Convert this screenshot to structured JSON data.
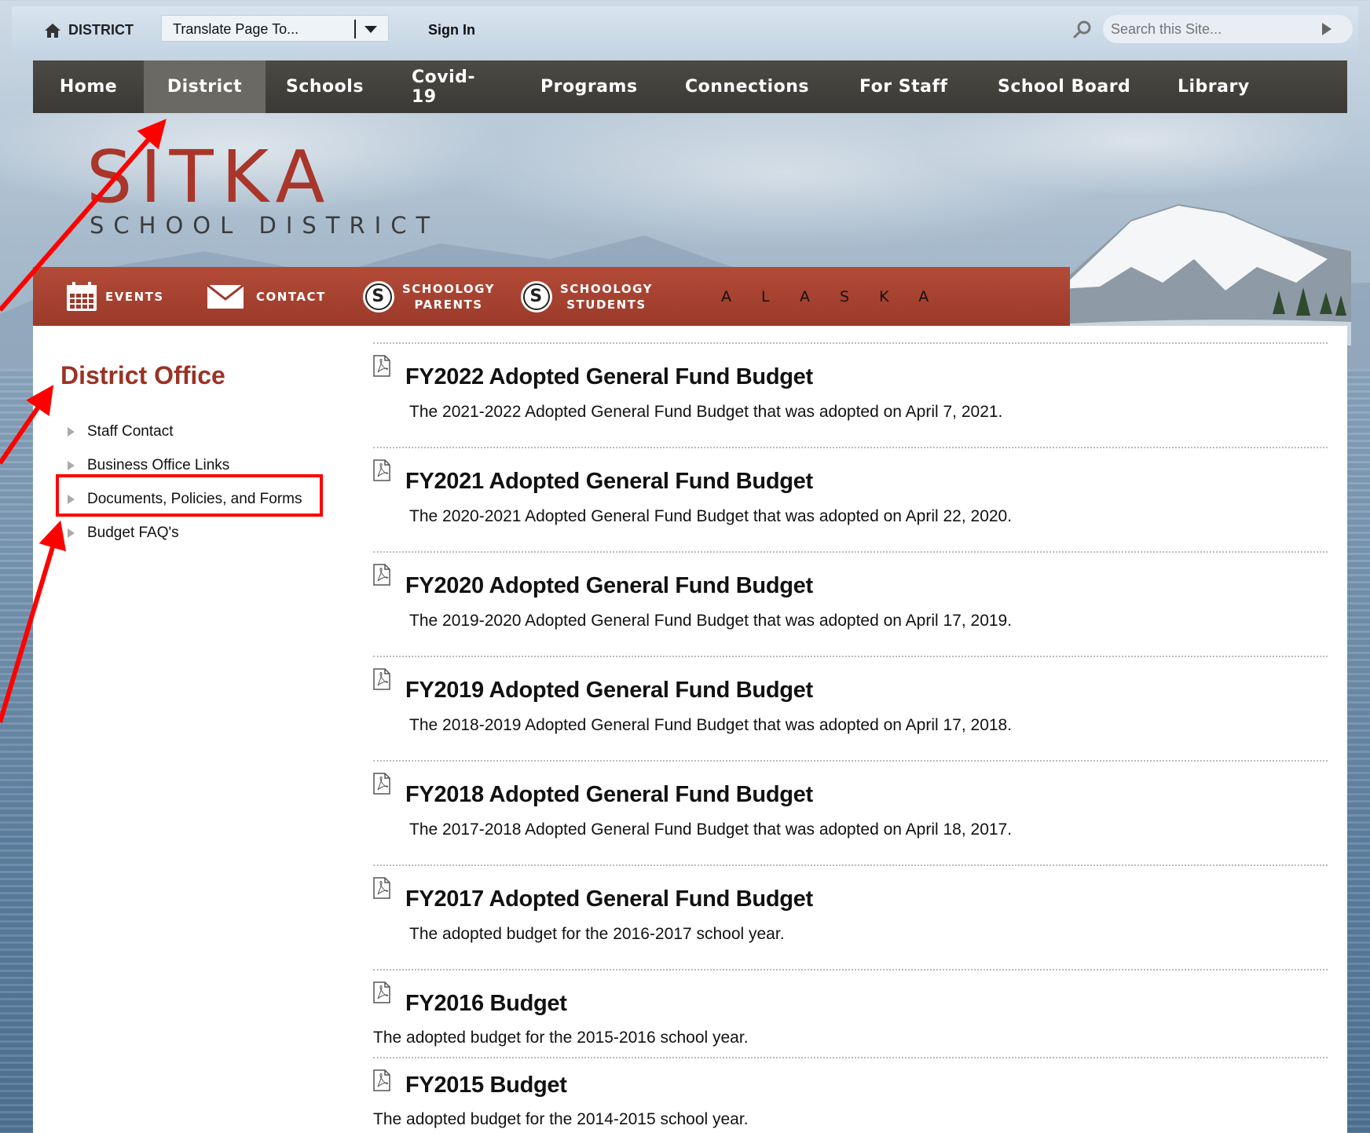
{
  "utility_bar": {
    "home_label": "DISTRICT",
    "translate_label": "Translate Page To...",
    "signin_label": "Sign In",
    "search_placeholder": "Search this Site..."
  },
  "main_nav": {
    "items": [
      {
        "label": "Home"
      },
      {
        "label": "District",
        "active": true
      },
      {
        "label": "Schools"
      },
      {
        "label": "Covid-19"
      },
      {
        "label": "Programs"
      },
      {
        "label": "Connections"
      },
      {
        "label": "For Staff"
      },
      {
        "label": "School Board"
      },
      {
        "label": "Library"
      }
    ]
  },
  "logo": {
    "title": "SITKA",
    "subtitle": "SCHOOL DISTRICT"
  },
  "quick_links": {
    "events": "EVENTS",
    "contact": "CONTACT",
    "schoology_parents": [
      "SCHOOLOGY",
      "PARENTS"
    ],
    "schoology_students": [
      "SCHOOLOGY",
      "STUDENTS"
    ],
    "schoology_letter": "S",
    "region": "ALASKA"
  },
  "sidebar": {
    "title": "District Office",
    "items": [
      {
        "label": "Staff Contact"
      },
      {
        "label": "Business Office Links"
      },
      {
        "label": "Documents, Policies, and Forms"
      },
      {
        "label": "Budget FAQ's"
      }
    ]
  },
  "documents": [
    {
      "title": "FY2022 Adopted General Fund Budget",
      "desc": "The 2021-2022 Adopted General Fund Budget that was adopted on April 7, 2021."
    },
    {
      "title": "FY2021 Adopted General Fund Budget",
      "desc": "The 2020-2021 Adopted General Fund Budget that was adopted on April 22, 2020."
    },
    {
      "title": "FY2020 Adopted General Fund Budget",
      "desc": "The 2019-2020 Adopted General Fund Budget that was adopted on April 17, 2019."
    },
    {
      "title": "FY2019 Adopted General Fund Budget",
      "desc": "The 2018-2019 Adopted General Fund Budget that was adopted on April 17, 2018."
    },
    {
      "title": "FY2018 Adopted General Fund Budget",
      "desc": "The 2017-2018 Adopted General Fund Budget that was adopted on April 18, 2017."
    },
    {
      "title": "FY2017 Adopted General Fund Budget",
      "desc": "The adopted budget for the 2016-2017 school year."
    },
    {
      "title": "FY2016 Budget",
      "desc": "The adopted budget for the 2015-2016 school year."
    },
    {
      "title": "FY2015 Budget",
      "desc": "The adopted budget for the 2014-2015 school year."
    }
  ],
  "colors": {
    "brand_red": "#a8362a",
    "nav_bg": "#3b3935",
    "annotation_red": "#ff0000"
  }
}
